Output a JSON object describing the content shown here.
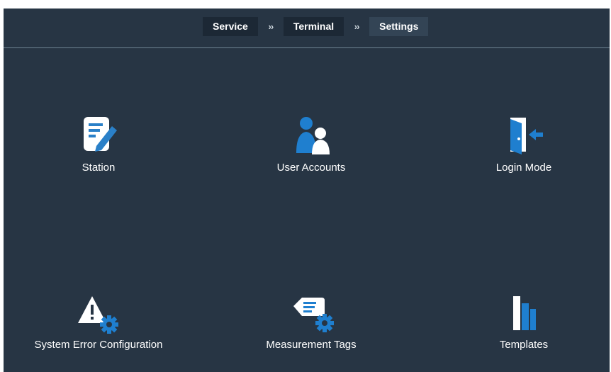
{
  "breadcrumb": {
    "items": [
      {
        "label": "Service"
      },
      {
        "label": "Terminal"
      },
      {
        "label": "Settings"
      }
    ],
    "separator": "››"
  },
  "tiles": [
    {
      "label": "Station",
      "icon": "station-edit-icon"
    },
    {
      "label": "User Accounts",
      "icon": "user-accounts-icon"
    },
    {
      "label": "Login Mode",
      "icon": "login-door-icon"
    },
    {
      "label": "System Error Configuration",
      "icon": "warning-gear-icon"
    },
    {
      "label": "Measurement Tags",
      "icon": "tag-gear-icon"
    },
    {
      "label": "Templates",
      "icon": "templates-bars-icon"
    }
  ],
  "colors": {
    "background": "#273544",
    "accent": "#1f7fcf",
    "text": "#ffffff"
  }
}
